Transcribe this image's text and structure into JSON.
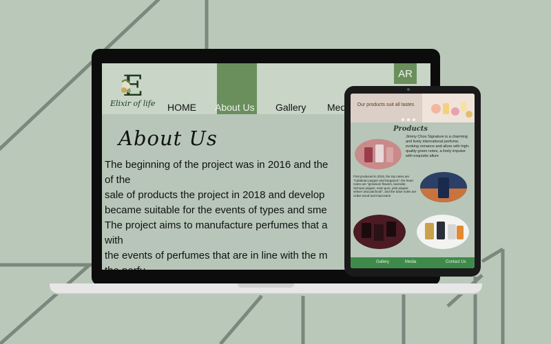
{
  "laptop": {
    "logo_text": "Elixir of life",
    "lang_button": "AR",
    "nav": {
      "home": "HOME",
      "about": "About Us",
      "gallery": "Gallery",
      "media": "Media"
    },
    "page_title": "About Us",
    "body_lines": [
      "The beginning of the project was in 2016 and the",
      "of the",
      "sale of products the project in 2018 and develop",
      "became suitable for the events of types and sme",
      "The project aims to manufacture perfumes that a",
      "with",
      "the events of perfumes that are in line with the m",
      "the perfu"
    ]
  },
  "tablet": {
    "hero_text": "Our products suit all tastes",
    "products_title": "Products",
    "product1_desc": "Jimmy Choo Signature is a charming and lively international perfume, evoking romance and allure with high-quality green notes, a lively impulse with exquisite allure",
    "product2_desc": "First produced in 2015, the top notes are \"Calabrian pepper and bergamot\", the heart notes are \"geranium flowers, lavender, Sichuan pepper, resin gum, pink pepper, vetiver and patchouli\", and the base notes are cedar wood and improsane",
    "footer": {
      "gallery": "Gallery",
      "media": "Media",
      "contact": "Contact Us"
    }
  },
  "colors": {
    "background": "#b9c8b9",
    "accent_green": "#6a8f5c",
    "footer_green": "#3f8a4a"
  }
}
